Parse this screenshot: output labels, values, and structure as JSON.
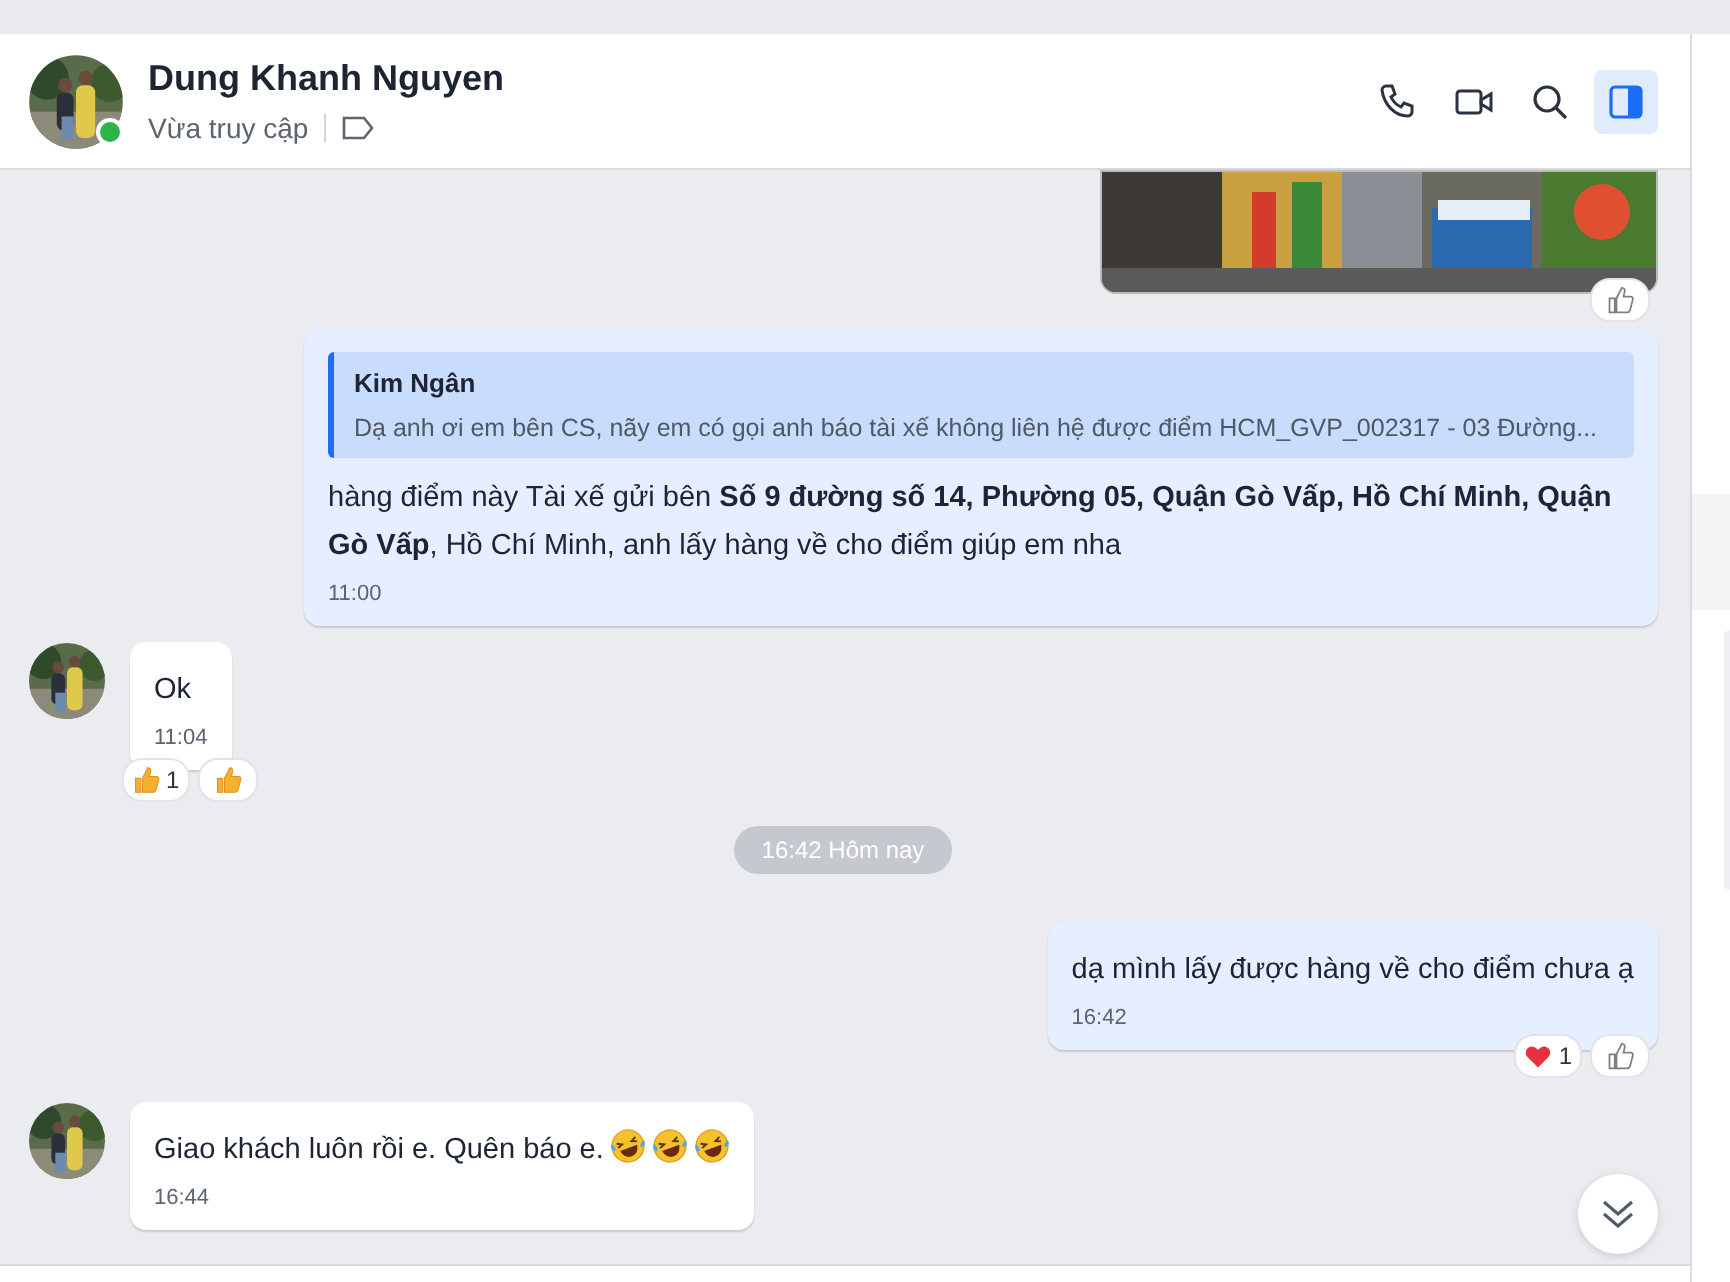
{
  "header": {
    "name": "Dung Khanh Nguyen",
    "status": "Vừa truy cập",
    "online": true,
    "actions": [
      {
        "kind": "phone"
      },
      {
        "kind": "video"
      },
      {
        "kind": "search"
      },
      {
        "kind": "panel",
        "selected": true
      }
    ]
  },
  "messages": [
    {
      "kind": "image-out",
      "reactions": [
        {
          "kind": "like-outline"
        }
      ]
    },
    {
      "kind": "quote-out",
      "quote_author": "Kim Ngân",
      "quote_text": "Dạ anh ơi em bên CS, nãy em có gọi anh báo tài xế không liên hệ được điểm HCM_GVP_002317 - 03 Đường...",
      "text": "hàng điểm này Tài xế gửi bên **Số 9 đường số 14, Phường 05, Quận Gò Vấp, Hồ Chí Minh, Quận Gò Vấp**, Hồ Chí Minh, anh lấy hàng về cho điểm giúp em nha",
      "time": "11:00"
    },
    {
      "kind": "text-in",
      "text": "Ok",
      "time": "11:04",
      "reactions": [
        {
          "kind": "thumb",
          "count": "1"
        },
        {
          "kind": "thumb"
        }
      ]
    },
    {
      "kind": "divider",
      "text": "16:42 Hôm nay"
    },
    {
      "kind": "text-out",
      "text": "dạ mình lấy được hàng về cho điểm chưa ạ",
      "time": "16:42",
      "reactions": [
        {
          "kind": "heart",
          "count": "1"
        },
        {
          "kind": "like-outline"
        }
      ]
    },
    {
      "kind": "text-in",
      "text": "Giao khách luôn rồi e. Quên báo e.",
      "time": "16:44",
      "emojis": [
        {
          "kind": "laughing"
        },
        {
          "kind": "laughing"
        },
        {
          "kind": "laughing"
        }
      ]
    }
  ]
}
